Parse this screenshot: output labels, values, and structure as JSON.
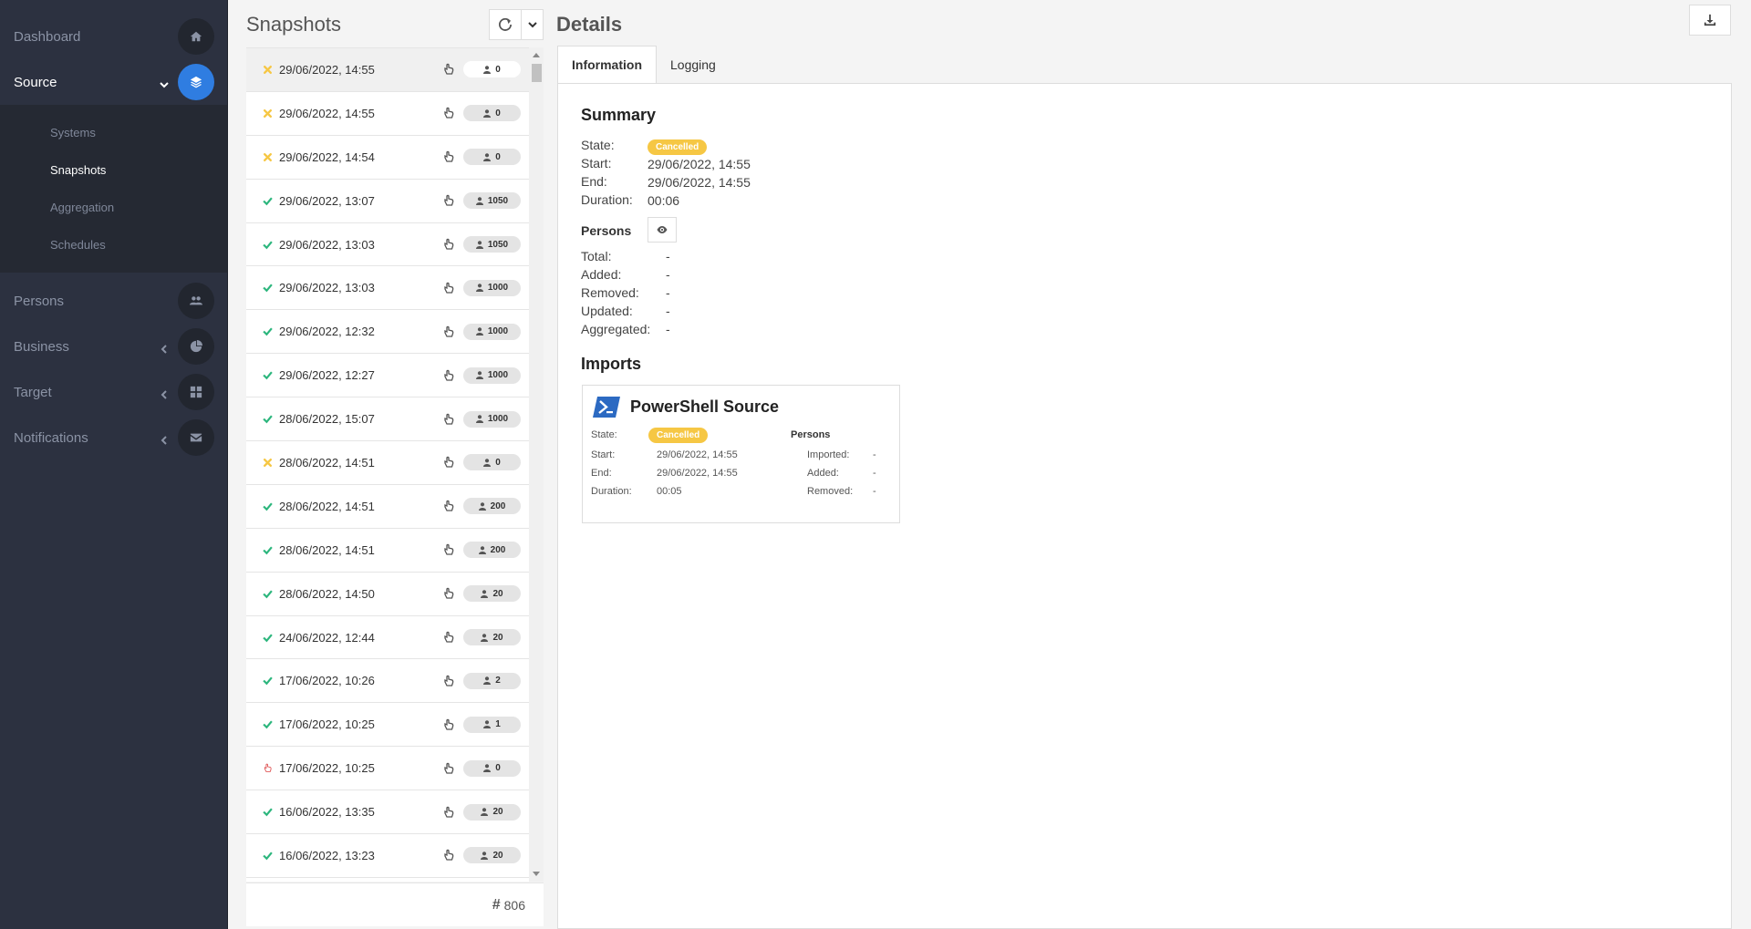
{
  "sidebar": {
    "items": [
      {
        "label": "Dashboard",
        "icon": "home-icon"
      },
      {
        "label": "Source",
        "icon": "layers-icon"
      },
      {
        "label": "Persons",
        "icon": "users-icon"
      },
      {
        "label": "Business",
        "icon": "pie-chart-icon"
      },
      {
        "label": "Target",
        "icon": "grid-icon"
      },
      {
        "label": "Notifications",
        "icon": "envelope-icon"
      }
    ],
    "source_sub": [
      "Systems",
      "Snapshots",
      "Aggregation",
      "Schedules"
    ]
  },
  "snapshots": {
    "title": "Snapshots",
    "rows": [
      {
        "date": "29/06/2022, 14:55",
        "status": "cancelled",
        "count": "0"
      },
      {
        "date": "29/06/2022, 14:55",
        "status": "cancelled",
        "count": "0"
      },
      {
        "date": "29/06/2022, 14:54",
        "status": "cancelled",
        "count": "0"
      },
      {
        "date": "29/06/2022, 13:07",
        "status": "success",
        "count": "1050"
      },
      {
        "date": "29/06/2022, 13:03",
        "status": "success",
        "count": "1050"
      },
      {
        "date": "29/06/2022, 13:03",
        "status": "success",
        "count": "1000"
      },
      {
        "date": "29/06/2022, 12:32",
        "status": "success",
        "count": "1000"
      },
      {
        "date": "29/06/2022, 12:27",
        "status": "success",
        "count": "1000"
      },
      {
        "date": "28/06/2022, 15:07",
        "status": "success",
        "count": "1000"
      },
      {
        "date": "28/06/2022, 14:51",
        "status": "cancelled",
        "count": "0"
      },
      {
        "date": "28/06/2022, 14:51",
        "status": "success",
        "count": "200"
      },
      {
        "date": "28/06/2022, 14:51",
        "status": "success",
        "count": "200"
      },
      {
        "date": "28/06/2022, 14:50",
        "status": "success",
        "count": "20"
      },
      {
        "date": "24/06/2022, 12:44",
        "status": "success",
        "count": "20"
      },
      {
        "date": "17/06/2022, 10:26",
        "status": "success",
        "count": "2"
      },
      {
        "date": "17/06/2022, 10:25",
        "status": "success",
        "count": "1"
      },
      {
        "date": "17/06/2022, 10:25",
        "status": "manual",
        "count": "0"
      },
      {
        "date": "16/06/2022, 13:35",
        "status": "success",
        "count": "20"
      },
      {
        "date": "16/06/2022, 13:23",
        "status": "success",
        "count": "20"
      }
    ],
    "total": "806"
  },
  "details": {
    "title": "Details",
    "tabs": [
      "Information",
      "Logging"
    ],
    "summary": {
      "heading": "Summary",
      "state_label": "State:",
      "state": "Cancelled",
      "start_label": "Start:",
      "start": "29/06/2022, 14:55",
      "end_label": "End:",
      "end": "29/06/2022, 14:55",
      "duration_label": "Duration:",
      "duration": "00:06"
    },
    "persons": {
      "heading": "Persons",
      "rows": [
        {
          "label": "Total:",
          "value": "-"
        },
        {
          "label": "Added:",
          "value": "-"
        },
        {
          "label": "Removed:",
          "value": "-"
        },
        {
          "label": "Updated:",
          "value": "-"
        },
        {
          "label": "Aggregated:",
          "value": "-"
        }
      ]
    },
    "imports": {
      "heading": "Imports",
      "card": {
        "title": "PowerShell Source",
        "state_label": "State:",
        "state": "Cancelled",
        "start_label": "Start:",
        "start": "29/06/2022, 14:55",
        "end_label": "End:",
        "end": "29/06/2022, 14:55",
        "duration_label": "Duration:",
        "duration": "00:05",
        "persons_heading": "Persons",
        "imported_label": "Imported:",
        "imported": "-",
        "added_label": "Added:",
        "added": "-",
        "removed_label": "Removed:",
        "removed": "-"
      }
    }
  },
  "colors": {
    "sidebar_bg": "#2c3140",
    "accent": "#2f7de1",
    "success": "#2cb67d",
    "cancelled": "#f6c744",
    "manual": "#e05a5a"
  }
}
